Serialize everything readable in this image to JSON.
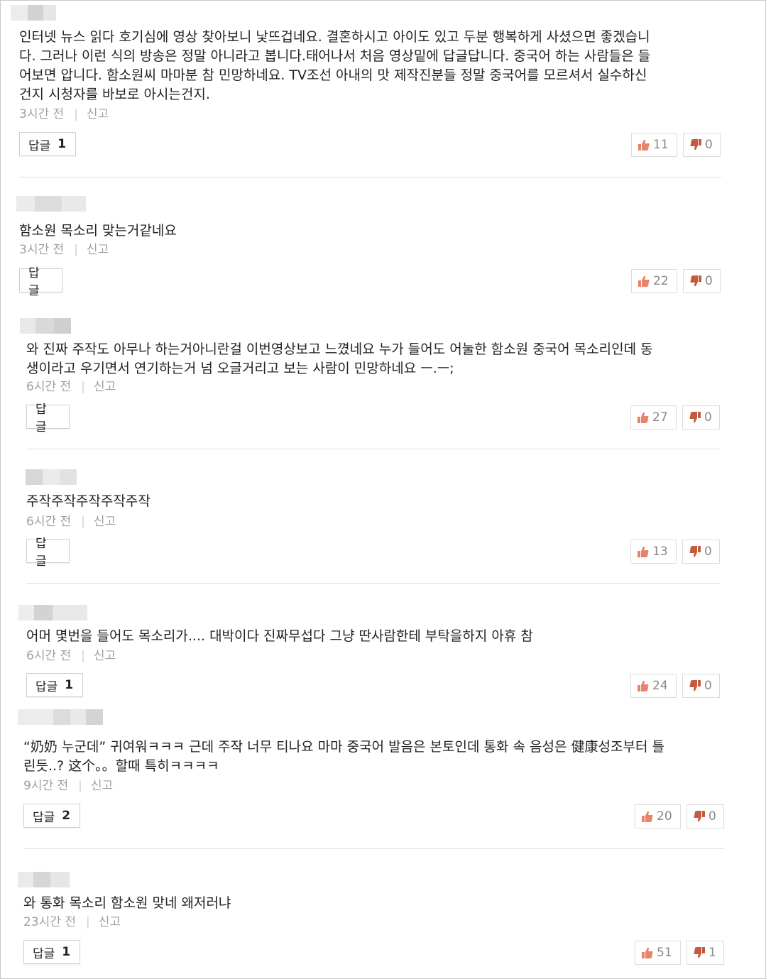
{
  "comments": [
    {
      "text": "인터넷 뉴스 읽다 호기심에 영상 찾아보니 낯뜨겁네요. 결혼하시고 아이도 있고 두분 행복하게 사셨으면 좋겠습니\n다. 그러나 이런 식의 방송은 정말 아니라고 봅니다.태어나서 처음 영상밑에 답글답니다. 중국어 하는 사람들은 들\n어보면 압니다. 함소원씨 마마분 참 민망하네요. TV조선 아내의 맛 제작진분들 정말 중국어를 모르셔서 실수하신\n건지 시청자를 바보로 아시는건지.",
      "time": "3시간 전",
      "report": "신고",
      "reply_label": "답글",
      "reply_count": "1",
      "likes": "11",
      "dislikes": "0"
    },
    {
      "text": "함소원 목소리 맞는거같네요",
      "time": "3시간 전",
      "report": "신고",
      "reply_label": "답글",
      "reply_count": "",
      "likes": "22",
      "dislikes": "0"
    },
    {
      "text": "와 진짜 주작도 아무나 하는거아니란걸 이번영상보고 느꼈네요 누가 들어도 어눌한 함소원 중국어 목소리인데 동\n생이라고 우기면서 연기하는거 넘 오글거리고 보는 사람이 민망하네요 ㅡ.ㅡ;",
      "time": "6시간 전",
      "report": "신고",
      "reply_label": "답글",
      "reply_count": "",
      "likes": "27",
      "dislikes": "0"
    },
    {
      "text": "주작주작주작주작주작",
      "time": "6시간 전",
      "report": "신고",
      "reply_label": "답글",
      "reply_count": "",
      "likes": "13",
      "dislikes": "0"
    },
    {
      "text": "어머 몇번을 들어도 목소리가.... 대박이다 진짜무섭다 그냥 딴사람한테 부탁을하지 아휴 참",
      "time": "6시간 전",
      "report": "신고",
      "reply_label": "답글",
      "reply_count": "1",
      "likes": "24",
      "dislikes": "0"
    },
    {
      "text": "“奶奶 누군데” 귀여워ㅋㅋㅋ 근데 주작 너무 티나요 마마 중국어 발음은 본토인데 통화 속 음성은 健康성조부터 틀\n린듯..? 这个。。할때 특히ㅋㅋㅋㅋ",
      "time": "9시간 전",
      "report": "신고",
      "reply_label": "답글",
      "reply_count": "2",
      "likes": "20",
      "dislikes": "0"
    },
    {
      "text": "와 통화 목소리 함소원 맞네 왜저러냐",
      "time": "23시간 전",
      "report": "신고",
      "reply_label": "답글",
      "reply_count": "1",
      "likes": "51",
      "dislikes": "1"
    }
  ],
  "colors": {
    "like_icon": "#e8826a",
    "dislike_icon": "#c45a3e",
    "meta_text": "#a0a0a0"
  }
}
